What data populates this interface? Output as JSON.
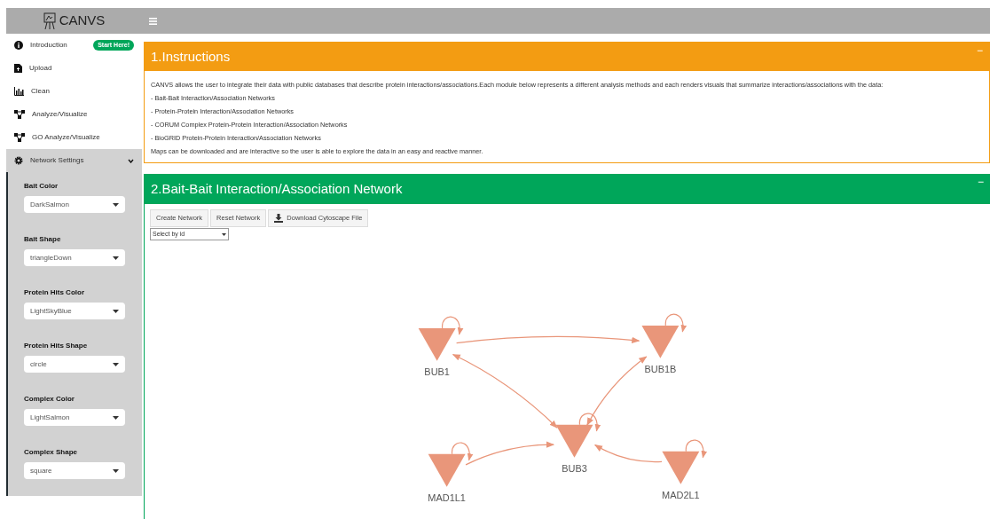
{
  "header": {
    "title": "CANVS"
  },
  "sidebar": {
    "items": [
      {
        "label": "Introduction",
        "badge": "Start Here!",
        "selected": false
      },
      {
        "label": "Upload",
        "selected": false
      },
      {
        "label": "Clean",
        "selected": false
      },
      {
        "label": "Analyze/Visualize",
        "selected": false
      },
      {
        "label": "GO Analyze/Visualize",
        "selected": false
      },
      {
        "label": "Network Settings",
        "selected": true,
        "expanded": true
      }
    ],
    "settings": [
      {
        "label": "Bait Color",
        "value": "DarkSalmon"
      },
      {
        "label": "Bait Shape",
        "value": "triangleDown"
      },
      {
        "label": "Protein Hits Color",
        "value": "LightSkyBlue"
      },
      {
        "label": "Protein Hits Shape",
        "value": "circle"
      },
      {
        "label": "Complex Color",
        "value": "LightSalmon"
      },
      {
        "label": "Complex Shape",
        "value": "square"
      }
    ]
  },
  "instructions": {
    "title": "1.Instructions",
    "collapse": "−",
    "lines": [
      "CANVS allows the user to integrate their data with public databases that describe protein interactions/associations.Each module below represents a different analysis methods and each renders visuals that summarize interactions/associations with the data:",
      "- Bait-Bait Interaction/Association Networks",
      "- Protein-Protein Interaction/Association Networks",
      "- CORUM Complex Protein-Protein Interaction/Association Networks",
      "- BioGRID Protein-Protein Interaction/Association Networks",
      "Maps can be downloaded and are interactive so the user is able to explore the data in an easy and reactive manner."
    ]
  },
  "network": {
    "title": "2.Bait-Bait Interaction/Association Network",
    "collapse": "−",
    "buttons": [
      {
        "label": "Create Network"
      },
      {
        "label": "Reset Network"
      },
      {
        "label": "Download Cytoscape File"
      }
    ],
    "select": {
      "value": "Select by id"
    },
    "nodes": [
      {
        "label": "BUB1"
      },
      {
        "label": "BUB1B"
      },
      {
        "label": "BUB3"
      },
      {
        "label": "MAD1L1"
      },
      {
        "label": "MAD2L1"
      }
    ]
  }
}
